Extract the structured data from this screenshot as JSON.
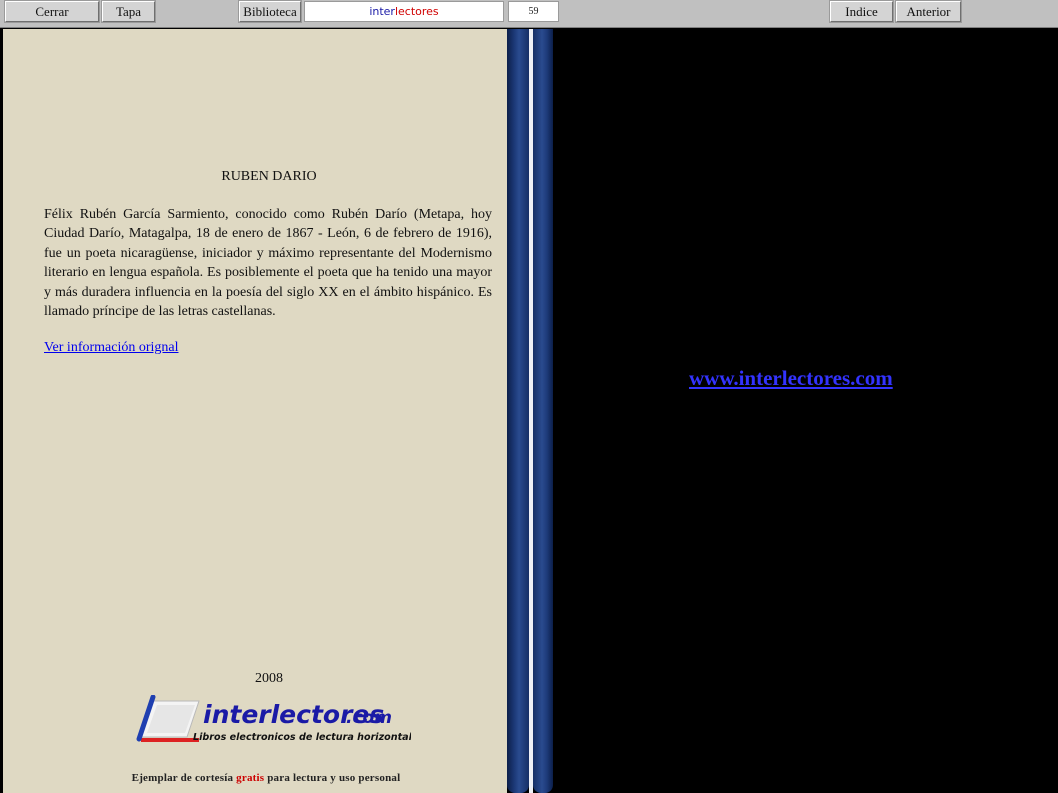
{
  "toolbar": {
    "cerrar": "Cerrar",
    "tapa": "Tapa",
    "biblioteca": "Biblioteca",
    "brand_part1": "inter",
    "brand_part2": "lectores",
    "page_number": "59",
    "indice": "Indice",
    "anterior": "Anterior"
  },
  "left_page": {
    "heading": "RUBEN DARIO",
    "bio": "Félix Rubén García Sarmiento, conocido como Rubén Darío (Metapa, hoy Ciudad Darío, Matagalpa, 18 de enero de 1867 - León, 6 de febrero de 1916), fue un poeta nicaragüense, iniciador y máximo representante del Modernismo literario en lengua española. Es posiblemente el poeta que ha tenido una mayor y más duradera influencia en la poesía del siglo XX en el ámbito hispánico. Es llamado príncipe de las letras castellanas.",
    "link_text": "Ver información orignal",
    "year": "2008",
    "logo_name": "interlectores",
    "logo_suffix": ".com",
    "logo_tagline": "Libros electronicos de lectura horizontal",
    "footer_part1": "Ejemplar de cortesía",
    "footer_red": "gratis",
    "footer_part2": "para lectura y uso personal"
  },
  "right_page": {
    "site_link": "www.interlectores.com"
  },
  "colors": {
    "toolbar": "#c0c0c0",
    "page": "#dfd9c3",
    "spine": "#1d3a79",
    "brand_blue": "#1a1aa6",
    "brand_red": "#d00000",
    "link": "#0000ee",
    "site_link": "#3333ff"
  }
}
